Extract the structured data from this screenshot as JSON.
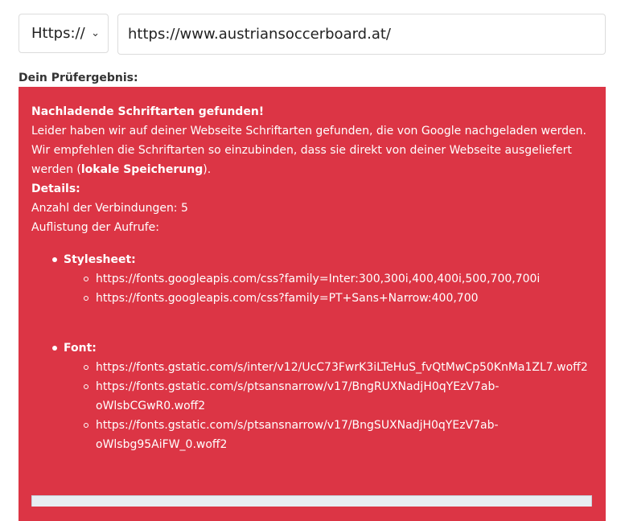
{
  "form": {
    "protocol_value": "Https://",
    "chevron_icon": "chevron-down-icon",
    "url_value": "https://www.austriansoccerboard.at/"
  },
  "result": {
    "label": "Dein Prüfergebnis:",
    "heading": "Nachladende Schriftarten gefunden!",
    "text_before_bold": "Leider haben wir auf deiner Webseite Schriftarten gefunden, die von Google nachgeladen werden. Wir empfehlen die Schriftarten so einzubinden, dass sie direkt von deiner Webseite ausgeliefert werden (",
    "bold_text": "lokale Speicherung",
    "text_after_bold": ").",
    "details_heading": "Details:",
    "connections": "Anzahl der Verbindungen: 5",
    "calls_label": "Auflistung der Aufrufe:",
    "groups": [
      {
        "title": "Stylesheet:",
        "items": [
          "https://fonts.googleapis.com/css?family=Inter:300,300i,400,400i,500,700,700i",
          "https://fonts.googleapis.com/css?family=PT+Sans+Narrow:400,700"
        ]
      },
      {
        "title": "Font:",
        "items": [
          "https://fonts.gstatic.com/s/inter/v12/UcC73FwrK3iLTeHuS_fvQtMwCp50KnMa1ZL7.woff2",
          "https://fonts.gstatic.com/s/ptsansnarrow/v17/BngRUXNadjH0qYEzV7ab-oWlsbCGwR0.woff2",
          "https://fonts.gstatic.com/s/ptsansnarrow/v17/BngSUXNadjH0qYEzV7ab-oWlsbg95AiFW_0.woff2"
        ]
      }
    ]
  },
  "colors": {
    "panel_background": "#dc3545",
    "panel_text": "#ffffff"
  }
}
